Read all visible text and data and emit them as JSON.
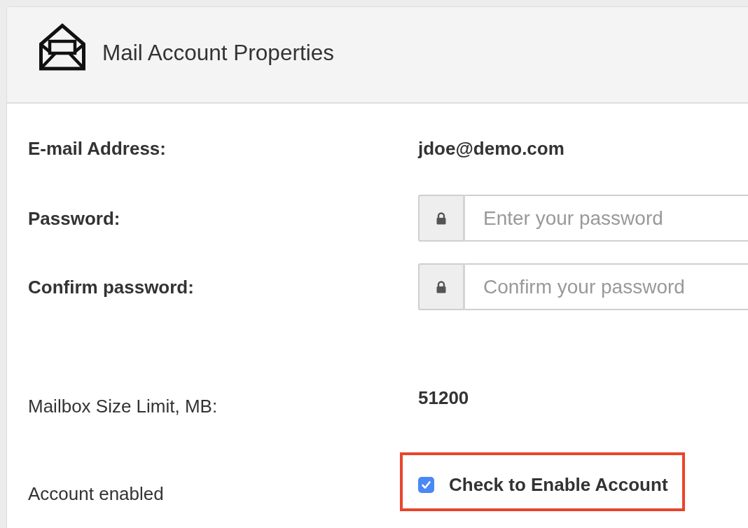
{
  "panel": {
    "title": "Mail Account Properties"
  },
  "fields": [
    {
      "kind": "text",
      "label": "E-mail Address:",
      "bold_label": true,
      "value": "jdoe@demo.com"
    },
    {
      "kind": "password",
      "label": "Password:",
      "bold_label": true,
      "placeholder": "Enter your password"
    },
    {
      "kind": "password",
      "label": "Confirm password:",
      "bold_label": true,
      "placeholder": "Confirm your password"
    },
    {
      "kind": "text",
      "label": "Mailbox Size Limit, MB:",
      "bold_label": false,
      "value": "51200"
    },
    {
      "kind": "checkbox",
      "label": "Account enabled",
      "bold_label": false,
      "option": "Check to Enable Account",
      "checked": true,
      "highlighted": true
    }
  ]
}
